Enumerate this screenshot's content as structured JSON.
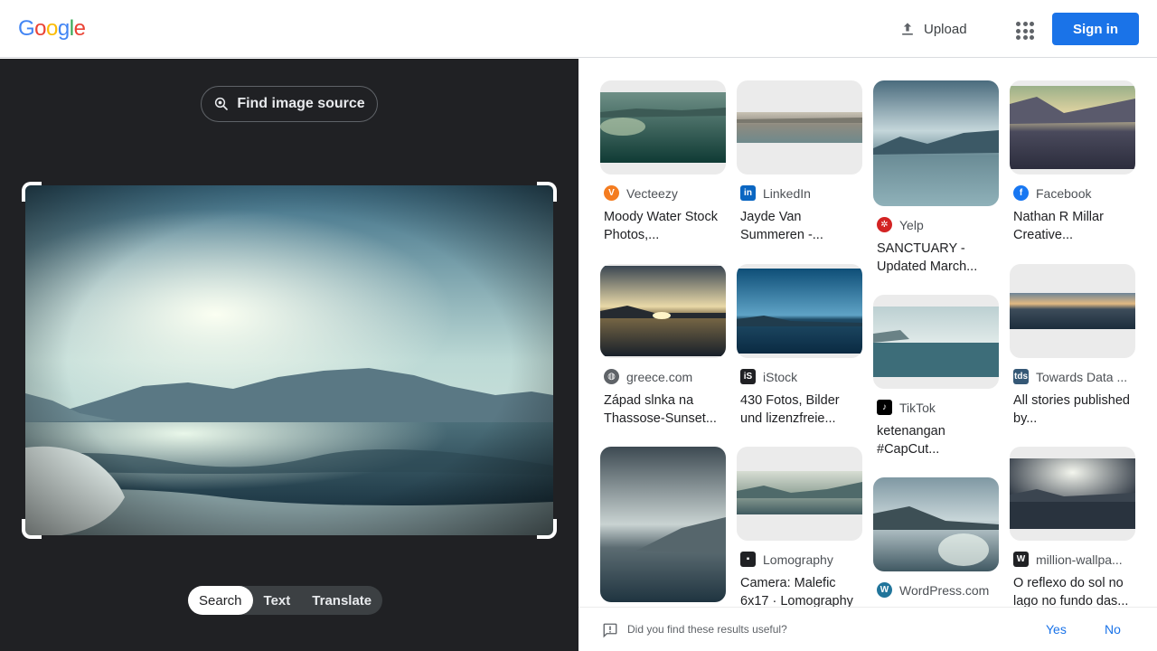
{
  "header": {
    "logo_letters": [
      "G",
      "o",
      "o",
      "g",
      "l",
      "e"
    ],
    "logo_colors": [
      "#4285F4",
      "#EA4335",
      "#FBBC05",
      "#4285F4",
      "#34A853",
      "#EA4335"
    ],
    "upload_label": "Upload",
    "apps_icon": "apps-grid-icon",
    "signin_label": "Sign in",
    "accent_color": "#1a73e8"
  },
  "left_panel": {
    "find_source_label": "Find image source",
    "modes": [
      {
        "label": "Search",
        "active": true
      },
      {
        "label": "Text",
        "active": false
      },
      {
        "label": "Translate",
        "active": false
      }
    ]
  },
  "results": [
    {
      "source": "Vecteezy",
      "title": "Moody Water Stock Photos,...",
      "favicon": "vecteezy-icon",
      "favicon_color": "#f47c20"
    },
    {
      "source": "LinkedIn",
      "title": "Jayde Van Summeren -...",
      "favicon": "linkedin-icon",
      "favicon_color": "#0a66c2"
    },
    {
      "source": "Yelp",
      "title": "SANCTUARY - Updated March...",
      "favicon": "yelp-icon",
      "favicon_color": "#d32323"
    },
    {
      "source": "Facebook",
      "title": "Nathan R Millar Creative...",
      "favicon": "facebook-icon",
      "favicon_color": "#1877f2"
    },
    {
      "source": "greece.com",
      "title": "Západ slnka na Thassose-Sunset...",
      "favicon": "globe-icon",
      "favicon_color": "#5f6368"
    },
    {
      "source": "iStock",
      "title": "430 Fotos, Bilder und lizenzfreie...",
      "favicon": "istock-icon",
      "favicon_color": "#202124"
    },
    {
      "source": "TikTok",
      "title": "ketenangan #CapCut...",
      "favicon": "tiktok-icon",
      "favicon_color": "#000000"
    },
    {
      "source": "Towards Data ...",
      "title": "All stories published by...",
      "favicon": "tds-icon",
      "favicon_color": "#355876"
    },
    {
      "source": "Lomography",
      "title": "Camera: Malefic 6x17 · Lomography",
      "favicon": "camera-icon",
      "favicon_color": "#202124"
    },
    {
      "source": "WordPress.com",
      "title": "",
      "favicon": "wordpress-icon",
      "favicon_color": "#21759b"
    },
    {
      "source": "million-wallpa...",
      "title": "O reflexo do sol no lago no fundo das...",
      "favicon": "wallpaper-site-icon",
      "favicon_color": "#202124"
    }
  ],
  "feedback": {
    "question": "Did you find these results useful?",
    "yes_label": "Yes",
    "no_label": "No"
  }
}
